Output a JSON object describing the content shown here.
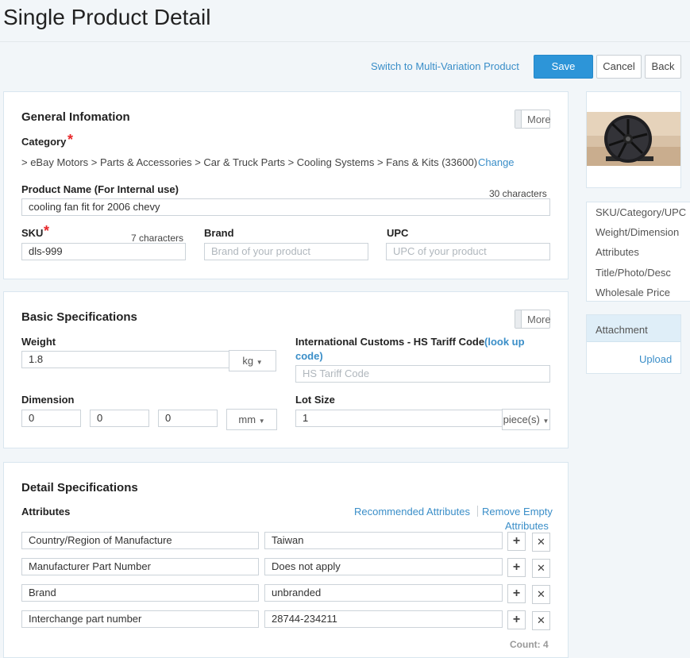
{
  "page": {
    "title": "Single Product Detail"
  },
  "actions": {
    "switch_link": "Switch to Multi-Variation Product",
    "save": "Save",
    "cancel": "Cancel",
    "back": "Back"
  },
  "general": {
    "title": "General Infomation",
    "more": "More",
    "category_label": "Category",
    "category_path": "> eBay Motors > Parts & Accessories > Car & Truck Parts > Cooling Systems > Fans & Kits (33600)",
    "change": "Change",
    "product_name_label": "Product Name (For Internal use)",
    "product_name_count": "30 characters",
    "product_name_value": "cooling fan fit for 2006 chevy",
    "sku_label": "SKU",
    "sku_count": "7 characters",
    "sku_value": "dls-999",
    "brand_label": "Brand",
    "brand_placeholder": "Brand of your product",
    "upc_label": "UPC",
    "upc_placeholder": "UPC of your product"
  },
  "basic": {
    "title": "Basic Specifications",
    "more": "More",
    "weight_label": "Weight",
    "weight_value": "1.8",
    "weight_unit": "kg",
    "hs_label": "International Customs - HS Tariff Code",
    "hs_link": "(look up code)",
    "hs_placeholder": "HS Tariff Code",
    "dimension_label": "Dimension",
    "dim_values": [
      "0",
      "0",
      "0"
    ],
    "dim_unit": "mm",
    "lot_label": "Lot Size",
    "lot_value": "1",
    "lot_unit": "piece(s)"
  },
  "detail": {
    "title": "Detail Specifications",
    "attributes_label": "Attributes",
    "recommended": "Recommended Attributes",
    "remove_empty": "Remove Empty Attributes",
    "rows": [
      {
        "name": "Country/Region of Manufacture",
        "value": "Taiwan"
      },
      {
        "name": "Manufacturer Part Number",
        "value": "Does not apply"
      },
      {
        "name": "Brand",
        "value": "unbranded"
      },
      {
        "name": "Interchange part number",
        "value": "28744-234211"
      }
    ],
    "count": "Count: 4"
  },
  "sidebar": {
    "nav": [
      "SKU/Category/UPC",
      "Weight/Dimension",
      "Attributes",
      "Title/Photo/Desc",
      "Wholesale Price"
    ],
    "attachment_title": "Attachment",
    "upload": "Upload"
  },
  "icons": {
    "plus": "plus-icon",
    "close": "close-icon",
    "caret": "caret-down-icon"
  }
}
